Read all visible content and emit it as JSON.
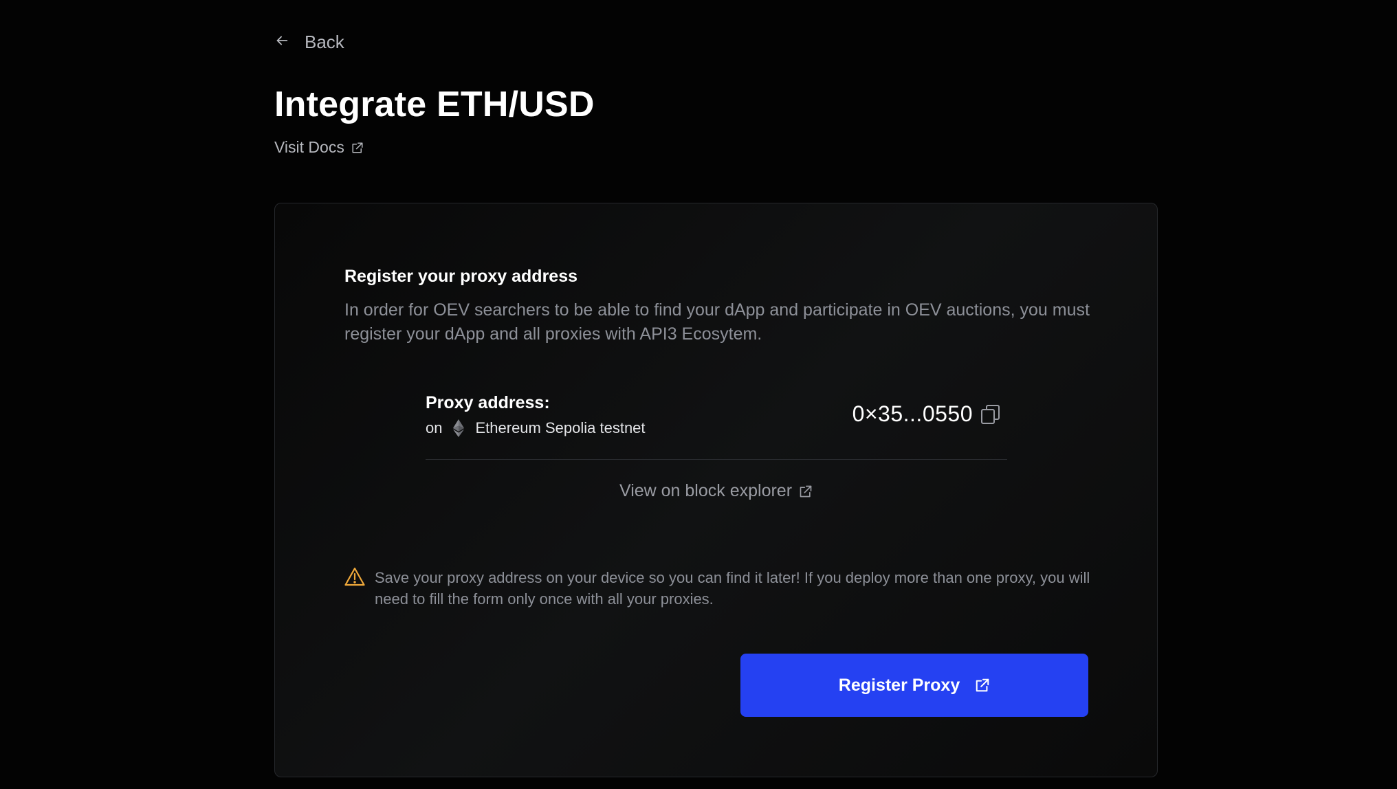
{
  "nav": {
    "back_label": "Back"
  },
  "header": {
    "title": "Integrate ETH/USD",
    "docs_label": "Visit Docs"
  },
  "card": {
    "heading": "Register your proxy address",
    "description": "In order for OEV searchers to be able to find your dApp and participate in OEV auctions, you must register your dApp and all proxies with API3 Ecosytem.",
    "proxy": {
      "label": "Proxy address:",
      "on_label": "on",
      "network": "Ethereum Sepolia testnet",
      "network_icon": "ethereum-icon",
      "address": "0×35...0550"
    },
    "explorer_label": "View on block explorer",
    "warning": "Save your proxy address on your device so you can find it later! If you deploy more than one proxy, you will need to fill the form only once with all your proxies.",
    "register_label": "Register Proxy"
  },
  "colors": {
    "background": "#030303",
    "accent": "#2541f2",
    "warning": "#f0a93b",
    "muted_text": "#8d9098"
  }
}
